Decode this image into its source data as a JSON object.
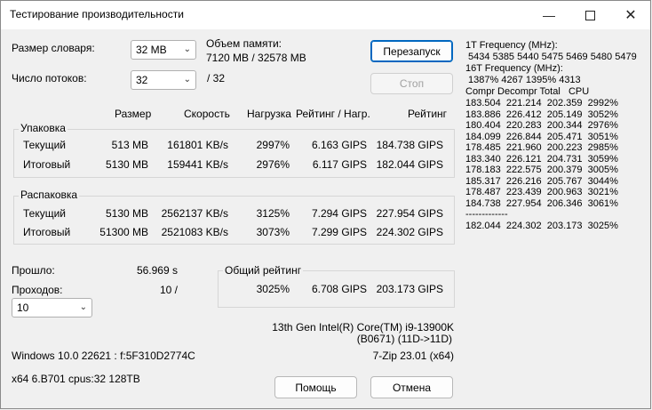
{
  "window": {
    "title": "Тестирование производительности"
  },
  "dict": {
    "label": "Размер словаря:",
    "value": "32 MB"
  },
  "threads": {
    "label": "Число потоков:",
    "value": "32",
    "of": "/ 32"
  },
  "memory": {
    "label": "Объем памяти:",
    "value": "7120 MB / 32578 MB"
  },
  "buttons": {
    "restart": "Перезапуск",
    "stop": "Стоп",
    "help": "Помощь",
    "cancel": "Отмена"
  },
  "headers": {
    "size": "Размер",
    "speed": "Скорость",
    "load": "Нагрузка",
    "rating_load": "Рейтинг / Нагр.",
    "rating": "Рейтинг"
  },
  "pack": {
    "title": "Упаковка",
    "rows": [
      {
        "label": "Текущий",
        "size": "513 MB",
        "speed": "161801 KB/s",
        "load": "2997%",
        "rating_load": "6.163 GIPS",
        "rating": "184.738 GIPS"
      },
      {
        "label": "Итоговый",
        "size": "5130 MB",
        "speed": "159441 KB/s",
        "load": "2976%",
        "rating_load": "6.117 GIPS",
        "rating": "182.044 GIPS"
      }
    ]
  },
  "unpack": {
    "title": "Распаковка",
    "rows": [
      {
        "label": "Текущий",
        "size": "5130 MB",
        "speed": "2562137 KB/s",
        "load": "3125%",
        "rating_load": "7.294 GIPS",
        "rating": "227.954 GIPS"
      },
      {
        "label": "Итоговый",
        "size": "51300 MB",
        "speed": "2521083 KB/s",
        "load": "3073%",
        "rating_load": "7.299 GIPS",
        "rating": "224.302 GIPS"
      }
    ]
  },
  "elapsed": {
    "label": "Прошло:",
    "value": "56.969 s"
  },
  "passes": {
    "label": "Проходов:",
    "value": "10 /",
    "select": "10"
  },
  "overall": {
    "title": "Общий рейтинг",
    "load": "3025%",
    "rating_load": "6.708 GIPS",
    "rating": "203.173 GIPS"
  },
  "cpu": {
    "name": "13th Gen Intel(R) Core(TM) i9-13900K",
    "stepping": "(B0671) (11D->11D)"
  },
  "system": {
    "os": "Windows 10.0 22621 : f:5F310D2774C",
    "version": "7-Zip 23.01 (x64)",
    "arch": "x64 6.B701 cpus:32 128TB"
  },
  "freq": {
    "label1": "1T Frequency (MHz):",
    "values1": " 5434 5385 5440 5475 5469 5480 5479",
    "label2": "16T Frequency (MHz):",
    "values2": " 1387% 4267 1395% 4313",
    "header": "Compr Decompr Total   CPU",
    "rows": [
      "183.504  221.214  202.359  2992%",
      "183.886  226.412  205.149  3052%",
      "180.404  220.283  200.344  2976%",
      "184.099  226.844  205.471  3051%",
      "178.485  221.960  200.223  2985%",
      "183.340  226.121  204.731  3059%",
      "178.183  222.575  200.379  3005%",
      "185.317  226.216  205.767  3044%",
      "178.487  223.439  200.963  3021%",
      "184.738  227.954  206.346  3061%"
    ],
    "separator": "-------------",
    "total": "182.044  224.302  203.173  3025%"
  }
}
